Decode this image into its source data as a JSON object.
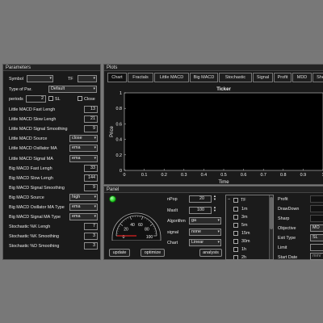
{
  "parameters": {
    "title": "Parameters",
    "symbol_label": "Symbol",
    "symbol_value": "",
    "tf_label": "TF",
    "tf_value": "",
    "type_label": "Type of Par.",
    "type_value": "Default",
    "periods_label": "periods",
    "periods_value": "2",
    "sl_label": "SL",
    "close_label": "Close",
    "rows": [
      {
        "label": "Little MACD Fast Lengh",
        "value": "13",
        "kind": "num"
      },
      {
        "label": "Little MACD Slow Lengh",
        "value": "21",
        "kind": "num"
      },
      {
        "label": "Little MACD Signal Smoothing",
        "value": "9",
        "kind": "num"
      },
      {
        "label": "Little MACD Source",
        "value": "close",
        "kind": "dd"
      },
      {
        "label": "Little MACD Osillator MA",
        "value": "ema",
        "kind": "dd"
      },
      {
        "label": "Little MACD Signal MA",
        "value": "ema",
        "kind": "dd"
      },
      {
        "label": "Big MACD Fast Lengh",
        "value": "33",
        "kind": "num"
      },
      {
        "label": "Big MACD Slow Lengh",
        "value": "144",
        "kind": "num"
      },
      {
        "label": "Big MACD Signal Smoothing",
        "value": "9",
        "kind": "num"
      },
      {
        "label": "Big MACD Source",
        "value": "high",
        "kind": "dd"
      },
      {
        "label": "Big MACD Osillator MA Type",
        "value": "ema",
        "kind": "dd"
      },
      {
        "label": "Big MACD Signal MA Type",
        "value": "ema",
        "kind": "dd"
      },
      {
        "label": "Stochastic %K Lengh",
        "value": "7",
        "kind": "num"
      },
      {
        "label": "Stochastic %K Smoothing",
        "value": "3",
        "kind": "num"
      },
      {
        "label": "Stochastic %D Smoothing",
        "value": "3",
        "kind": "num"
      }
    ]
  },
  "plots": {
    "title": "Plots",
    "tabs": [
      "Chart",
      "Fractals",
      "Little MACD",
      "Big MACD",
      "Stochastic",
      "Signal",
      "Profit",
      "MDD",
      "She"
    ]
  },
  "chart_data": {
    "type": "line",
    "title": "Ticker",
    "xlabel": "Time",
    "ylabel": "Price",
    "x_ticks": [
      "0",
      "0.1",
      "0.2",
      "0.3",
      "0.4",
      "0.5",
      "0.6",
      "0.7",
      "0.8",
      "0.9",
      "1"
    ],
    "y_ticks": [
      "0",
      "0.2",
      "0.4",
      "0.6",
      "0.8",
      "1"
    ],
    "xlim": [
      0,
      1
    ],
    "ylim": [
      0,
      1
    ],
    "series": []
  },
  "panel": {
    "title": "Panel",
    "status_color": "#22cc22",
    "gauge_ticks": [
      "0",
      "20",
      "40",
      "60",
      "80",
      "100"
    ],
    "gauge_value": 0,
    "npop_label": "nPop",
    "npop_value": "20",
    "maxit_label": "MaxIt",
    "maxit_value": "100",
    "algorithm_label": "Algorithm",
    "algorithm_value": "ga",
    "signal_label": "signal",
    "signal_value": "none",
    "chart_label": "Chart",
    "chart_value": "Linear",
    "update_label": "update",
    "optimize_label": "optimize",
    "analysis_label": "analysis",
    "tf_root": "TF",
    "tf_items": [
      "1m",
      "3m",
      "5m",
      "15m",
      "30m",
      "1h",
      "2h"
    ],
    "right_labels": [
      "Profit",
      "DrawDown",
      "Sharp",
      "Objective",
      "Exit Type",
      "Limit",
      "Start Date"
    ],
    "objective_value": "MO",
    "exit_value": "SL",
    "start_date_value": "mm/"
  }
}
